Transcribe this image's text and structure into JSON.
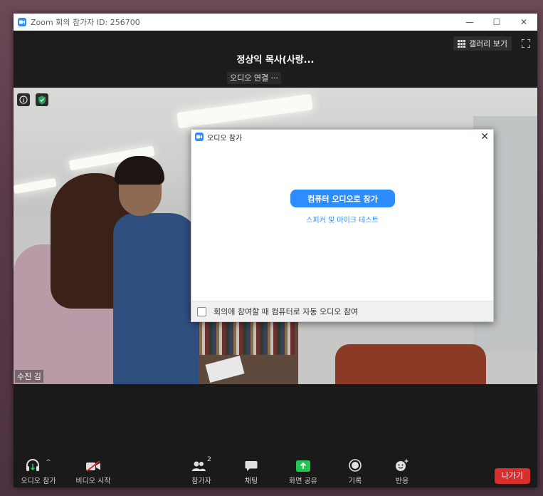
{
  "window": {
    "title": "Zoom 회의 참가자 ID: 256700",
    "controls": [
      "—",
      "☐",
      "✕"
    ]
  },
  "header": {
    "gallery_view_label": "갤러리 보기",
    "speaker_name": "정상익 목사(사랑...",
    "audio_connection_label": "오디오 연결 ···"
  },
  "video": {
    "participant_name": "수진 김"
  },
  "dialog": {
    "title": "오디오 참가",
    "close_glyph": "✕",
    "join_computer_audio_label": "컴퓨터 오디오로 참가",
    "test_link_label": "스피커 및 마이크 테스트",
    "auto_join_checkbox_label": "회의에 참여할 때 컴퓨터로 자동 오디오 참여",
    "auto_join_checked": false
  },
  "toolbar": {
    "join_audio_label": "오디오 참가",
    "start_video_label": "비디오 시작",
    "participants_label": "참가자",
    "participants_count": "2",
    "chat_label": "채팅",
    "share_screen_label": "화면 공유",
    "record_label": "기록",
    "reactions_label": "반응",
    "leave_label": "나가기"
  },
  "colors": {
    "accent": "#2d8cff",
    "share_green": "#23c552",
    "leave_red": "#d92e2e",
    "shield_green": "#23a55a"
  }
}
